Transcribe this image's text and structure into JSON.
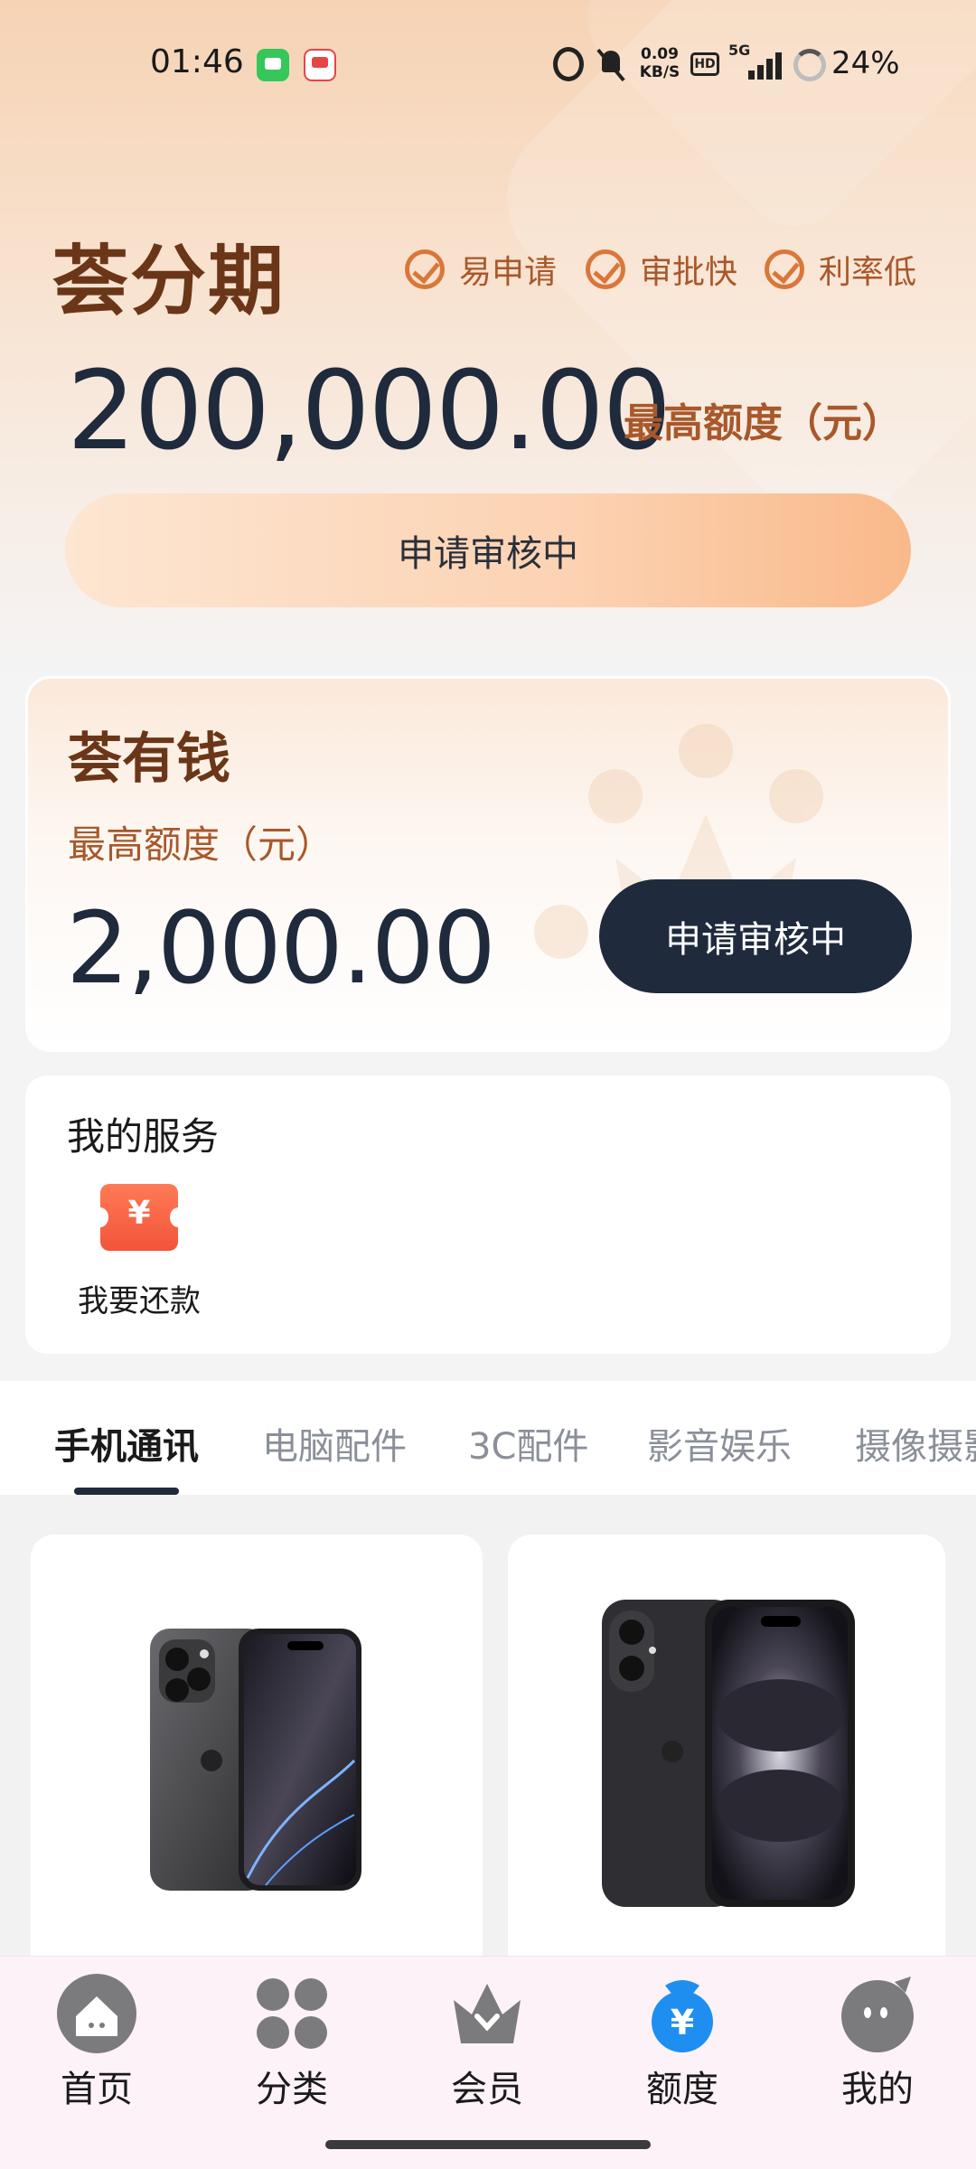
{
  "status_bar": {
    "time": "01:46",
    "speed_value": "0.09",
    "speed_unit": "KB/S",
    "hd": "HD",
    "network": "5G",
    "battery": "24%"
  },
  "hero": {
    "title": "荟分期",
    "features": [
      "易申请",
      "审批快",
      "利率低"
    ],
    "amount": "200,000.00",
    "amount_label": "最高额度（元）",
    "button_label": "申请审核中"
  },
  "card2": {
    "title": "荟有钱",
    "amount_label": "最高额度（元）",
    "amount": "2,000.00",
    "button_label": "申请审核中"
  },
  "services": {
    "title": "我的服务",
    "items": [
      {
        "label": "我要还款",
        "icon": "repay-coupon-icon",
        "symbol": "¥"
      }
    ]
  },
  "tabs": [
    "手机通讯",
    "电脑配件",
    "3C配件",
    "影音娱乐",
    "摄像摄影"
  ],
  "bottom_nav": [
    {
      "label": "首页",
      "icon": "home-icon"
    },
    {
      "label": "分类",
      "icon": "category-icon"
    },
    {
      "label": "会员",
      "icon": "crown-icon"
    },
    {
      "label": "额度",
      "icon": "credit-icon"
    },
    {
      "label": "我的",
      "icon": "profile-icon"
    }
  ],
  "colors": {
    "brand_brown": "#6b3618",
    "accent_orange": "#d9773a",
    "dark_navy": "#1f2a3c"
  }
}
